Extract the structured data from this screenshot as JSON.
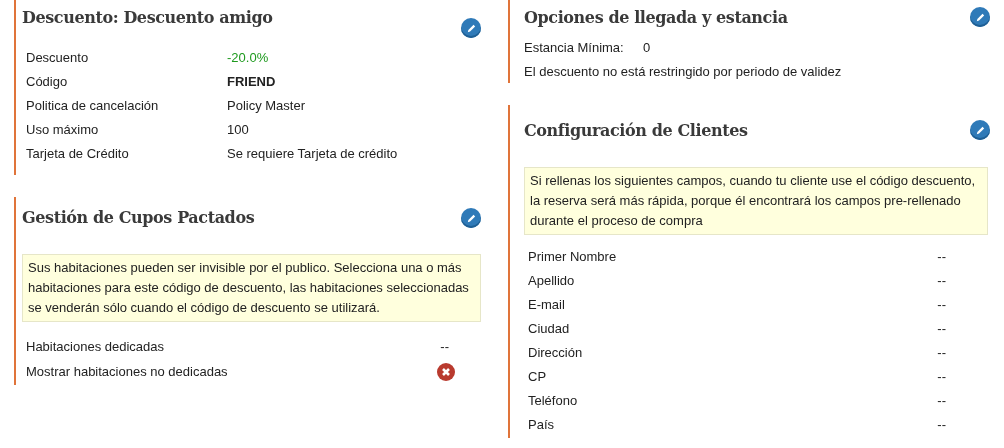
{
  "discount": {
    "title": "Descuento: Descuento amigo",
    "rows": [
      {
        "label": "Descuento",
        "value": "-20.0%",
        "kind": "positive"
      },
      {
        "label": "Código",
        "value": "FRIEND",
        "kind": "strong"
      },
      {
        "label": "Politica de cancelación",
        "value": "Policy Master",
        "kind": "plain"
      },
      {
        "label": "Uso máximo",
        "value": "100",
        "kind": "plain"
      },
      {
        "label": "Tarjeta de Crédito",
        "value": "Se requiere Tarjeta de crédito",
        "kind": "plain"
      }
    ]
  },
  "quota": {
    "title": "Gestión de Cupos Pactados",
    "note": "Sus habitaciones pueden ser invisible por el publico. Selecciona una o más habitaciones para este código de descuento, las habitaciones seleccionadas se venderán sólo cuando el código de descuento se utilizará.",
    "rows": [
      {
        "label": "Habitaciones dedicadas",
        "kind": "text",
        "value": "--"
      },
      {
        "label": "Mostrar habitaciones no dedicadas",
        "kind": "flag",
        "on": false
      }
    ]
  },
  "arrival": {
    "title": "Opciones de llegada y estancia",
    "min_stay_label": "Estancia Mínima:",
    "min_stay_value": "0",
    "validity_note": "El descuento no está restringido por periodo de validez"
  },
  "clients": {
    "title": "Configuración de Clientes",
    "note": "Si rellenas los siguientes campos, cuando tu cliente use el código descuento, la reserva será más rápida, porque él encontrará los campos pre-rellenado durante el proceso de compra",
    "rows": [
      {
        "label": "Primer Nombre",
        "value": "--"
      },
      {
        "label": "Apellido",
        "value": "--"
      },
      {
        "label": "E-mail",
        "value": "--"
      },
      {
        "label": "Ciudad",
        "value": "--"
      },
      {
        "label": "Dirección",
        "value": "--"
      },
      {
        "label": "CP",
        "value": "--"
      },
      {
        "label": "Teléfono",
        "value": "--"
      },
      {
        "label": "País",
        "value": "--"
      }
    ]
  }
}
